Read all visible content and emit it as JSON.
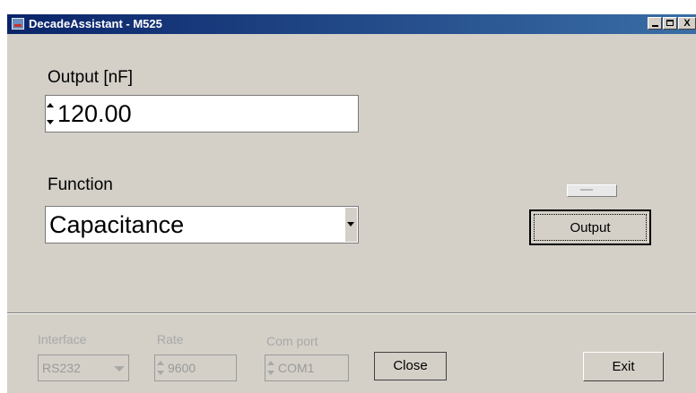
{
  "window": {
    "title": "DecadeAssistant - M525",
    "controls": {
      "minimize": "_",
      "maximize": "□",
      "close": "X"
    }
  },
  "output": {
    "label": "Output [nF]",
    "value": "120.00"
  },
  "function": {
    "label": "Function",
    "selected": "Capacitance"
  },
  "buttons": {
    "output": "Output",
    "close": "Close",
    "exit": "Exit"
  },
  "connection": {
    "interface_label": "Interface",
    "interface_value": "RS232",
    "rate_label": "Rate",
    "rate_value": "9600",
    "comport_label": "Com port",
    "comport_value": "COM1"
  },
  "colors": {
    "title_bar": "#0a246a",
    "face": "#d4d0c8",
    "disabled_text": "#a8a8a8"
  }
}
